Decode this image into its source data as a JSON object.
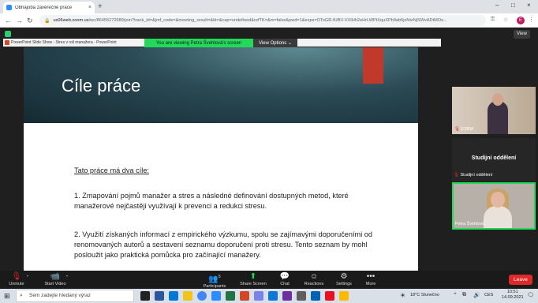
{
  "browser": {
    "tab_title": "Obhajoba závěrečné práce",
    "tab_close": "×",
    "new_tab": "+",
    "url_domain": "us06web.zoom.us",
    "url_path": "/wc/86455272689/join?track_id=&jmf_code=&meeting_result=&tk=&cap=undefined&refTK=&m=false&pwd=1&exps=OToGR-fUBV-VXIHh2eHrLWPtXquXPb9ab5jxNtzNjSWvADtMOo...",
    "win_min": "–",
    "win_max": "□",
    "win_close": "×",
    "profile_initial": "E"
  },
  "zoom": {
    "view_label": "View",
    "banner_text": "You are viewing Petra Švehlová's screen",
    "view_options": "View Options",
    "ppt_title": "PowerPoint Slide Show - Stres v roli manažera - PowerPoint"
  },
  "slide": {
    "title": "Cíle práce",
    "heading": "Tato práce má dva cíle:",
    "point1": "1. Zmapování pojmů manažer a stres a následné definování dostupných metod, které manažerové nejčastěji využívají k prevenci a redukci stresu.",
    "point2": "2. Využití získaných informací z empirického výzkumu, spolu se zajímavými doporučeními od renomovaných autorů a sestavení seznamu doporučení proti stresu. Tento seznam by mohl posloužit jako praktická pomůcka pro začínající manažery."
  },
  "participants": {
    "p1_name": "ESBM",
    "p2_name": "Studijní oddělení",
    "p2_label": "Studijní oddělení",
    "p3_name": "Petra Švehlová"
  },
  "toolbar": {
    "unmute": "Unmute",
    "start_video": "Start Video",
    "participants": "Participants",
    "participants_count": "5",
    "share_screen": "Share Screen",
    "chat": "Chat",
    "reactions": "Reactions",
    "settings": "Settings",
    "more": "More",
    "leave": "Leave"
  },
  "taskbar": {
    "search_placeholder": "Sem zadejte hledaný výraz",
    "weather": "18°C Slunečno",
    "language": "CES",
    "time": "10:51",
    "date": "14.09.2021"
  }
}
